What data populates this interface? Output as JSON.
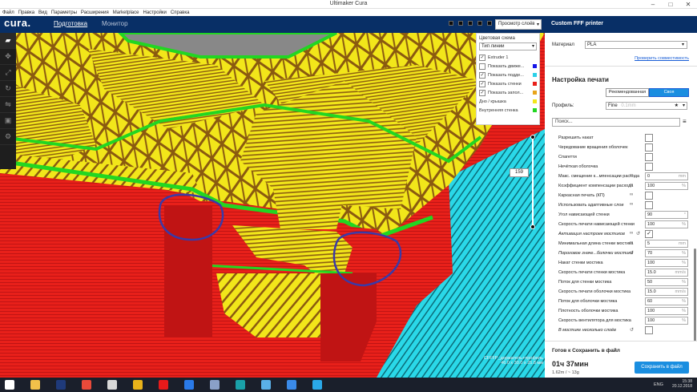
{
  "window": {
    "title": "Ultimaker Cura",
    "controls": [
      "–",
      "□",
      "✕"
    ]
  },
  "menu": [
    "Файл",
    "Правка",
    "Вид",
    "Параметры",
    "Расширения",
    "Marketplace",
    "Настройки",
    "Справка"
  ],
  "header": {
    "logo": "cura.",
    "tab_prepare": "Подготовка",
    "tab_monitor": "Монитор",
    "view_mode": "Просмотр слоёв"
  },
  "left_toolbar": [
    "open-file-icon",
    "move-icon",
    "scale-icon",
    "rotate-icon",
    "mirror-icon",
    "support-blocker-icon",
    "per-model-settings-icon"
  ],
  "color_scheme": {
    "label": "Цветовая схема",
    "selected": "Тип линии",
    "legend": [
      {
        "label": "Extruder 1",
        "checked": true,
        "color": ""
      },
      {
        "label": "Показать движе...",
        "checked": false,
        "color": "#1515e8"
      },
      {
        "label": "Показать подде...",
        "checked": true,
        "color": "#2ad0e8"
      },
      {
        "label": "Показать стенки",
        "checked": true,
        "color": "#e8201a"
      },
      {
        "label": "Показать запол...",
        "checked": true,
        "color": "#e8a41a"
      },
      {
        "label": "Дно / крышка",
        "checked": null,
        "color": "#f2e61a"
      },
      {
        "label": "Внутренняя стенка",
        "checked": null,
        "color": "#22d622"
      }
    ]
  },
  "layer_slider": {
    "value": "159"
  },
  "job": {
    "name": "CFFFP_держатель+профиль",
    "dimensions": "46.0 x 30.0 x 25.8 мм"
  },
  "right_panel": {
    "printer": "Custom FFF printer",
    "material_label": "Материал",
    "material_value": "PLA",
    "compat_link": "Проверить совместимость",
    "print_settings_title": "Настройка печати",
    "mode_recommended": "Рекомендованная",
    "mode_custom": "Своя",
    "profile_label": "Профиль:",
    "profile_value": "Fine",
    "profile_hint": "0.1mm",
    "search_placeholder": "Поиск...",
    "settings": [
      {
        "name": "Разрешить накат",
        "type": "check",
        "checked": false
      },
      {
        "name": "Чередование вращения оболочек",
        "type": "check",
        "checked": false
      },
      {
        "name": "Спагетти",
        "type": "check",
        "checked": false
      },
      {
        "name": "Нечёткая оболочка",
        "type": "check",
        "checked": false
      },
      {
        "name": "Макс. смещение к...мпенсации расхода",
        "type": "input",
        "value": "0",
        "unit": "mm",
        "icon": "link-icon"
      },
      {
        "name": "Коэффициент компенсации расхода",
        "type": "input",
        "value": "100",
        "unit": "%",
        "icon": "link-icon"
      },
      {
        "name": "Каркасная печать (КП)",
        "type": "check",
        "checked": false,
        "icon": "link-icon"
      },
      {
        "name": "Использовать адаптивные слои",
        "type": "check",
        "checked": false,
        "icon": "link-icon"
      },
      {
        "name": "Угол нависающей стенки",
        "type": "input",
        "value": "90",
        "unit": "°"
      },
      {
        "name": "Скорость печати нависающей стенки",
        "type": "input",
        "value": "100",
        "unit": "%"
      },
      {
        "name": "Активация настроек мостиков",
        "type": "check",
        "checked": true,
        "italic": true,
        "icon": "link-icon",
        "icon2": "reset-icon"
      },
      {
        "name": "Минимальная длина стенки мостика",
        "type": "input",
        "value": "5",
        "unit": "mm",
        "icon": "link-icon"
      },
      {
        "name": "Пороговое значе...болочки мостика",
        "type": "input",
        "value": "70",
        "unit": "%",
        "italic": true,
        "icon": "reset-icon"
      },
      {
        "name": "Накат стенки мостика",
        "type": "input",
        "value": "100",
        "unit": "%"
      },
      {
        "name": "Скорость печати стенки мостика",
        "type": "input",
        "value": "15.0",
        "unit": "mm/s"
      },
      {
        "name": "Поток для стенки мостика",
        "type": "input",
        "value": "50",
        "unit": "%"
      },
      {
        "name": "Скорость печати оболочки мостика",
        "type": "input",
        "value": "15.0",
        "unit": "mm/s"
      },
      {
        "name": "Поток для оболочки мостика",
        "type": "input",
        "value": "60",
        "unit": "%"
      },
      {
        "name": "Плотность оболочки мостика",
        "type": "input",
        "value": "100",
        "unit": "%"
      },
      {
        "name": "Скорость вентилятора для мостика",
        "type": "input",
        "value": "100",
        "unit": "%"
      },
      {
        "name": "В мостике несколько слоёв",
        "type": "check",
        "checked": false,
        "italic": true,
        "icon": "reset-icon"
      }
    ],
    "ready_title": "Готов к Сохранить в файл",
    "time": "01ч 37мин",
    "material_est": "1.62m / ~ 13g",
    "save_button": "Сохранить в файл"
  },
  "taskbar": {
    "apps": [
      {
        "name": "start-icon",
        "color": "#ffffff"
      },
      {
        "name": "explorer-icon",
        "color": "#f2c14a"
      },
      {
        "name": "photoshop-icon",
        "color": "#1f3a7a"
      },
      {
        "name": "rainbow-icon",
        "color": "#e84a3a"
      },
      {
        "name": "paint-icon",
        "color": "#d8d8d8"
      },
      {
        "name": "chrome-icon",
        "color": "#e8b21a"
      },
      {
        "name": "yandex-icon",
        "color": "#e81a1a"
      },
      {
        "name": "edge-icon",
        "color": "#2a7ae8"
      },
      {
        "name": "network-icon",
        "color": "#8aa0c8"
      },
      {
        "name": "arduino-icon",
        "color": "#1aa0a8"
      },
      {
        "name": "sync-icon",
        "color": "#5ab0e8"
      },
      {
        "name": "paint-net-icon",
        "color": "#3a8ae8"
      },
      {
        "name": "cura-icon",
        "color": "#2aa8e8"
      }
    ],
    "lang": "ENG",
    "time": "15:38",
    "date": "20.12.2018"
  }
}
